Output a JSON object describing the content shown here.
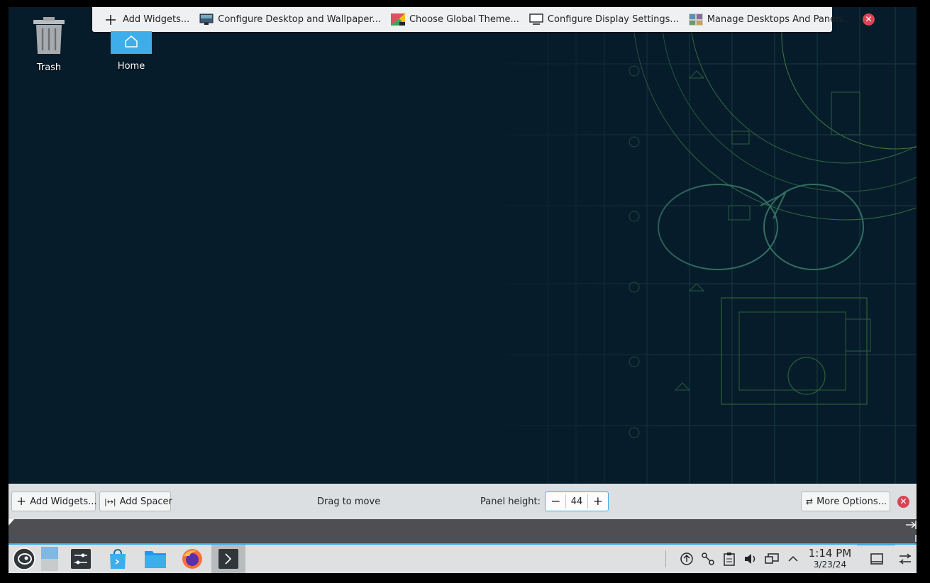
{
  "desktop_toolbar": {
    "add_widgets": "Add Widgets...",
    "configure_desktop": "Configure Desktop and Wallpaper...",
    "global_theme": "Choose Global Theme...",
    "display_settings": "Configure Display Settings...",
    "manage_desktops": "Manage Desktops And Panels..."
  },
  "desktop_icons": {
    "trash": "Trash",
    "home": "Home"
  },
  "panel_config": {
    "add_widgets": "Add Widgets...",
    "add_spacer": "Add Spacer",
    "drag_to_move": "Drag to move",
    "panel_height_label": "Panel height:",
    "panel_height_value": "44",
    "more_options": "More Options..."
  },
  "clock": {
    "time": "1:14 PM",
    "date": "3/23/24"
  },
  "colors": {
    "accent": "#3daee9",
    "close": "#da4453",
    "wallpaper": "#071c2b",
    "panel": "#dee0e2"
  }
}
